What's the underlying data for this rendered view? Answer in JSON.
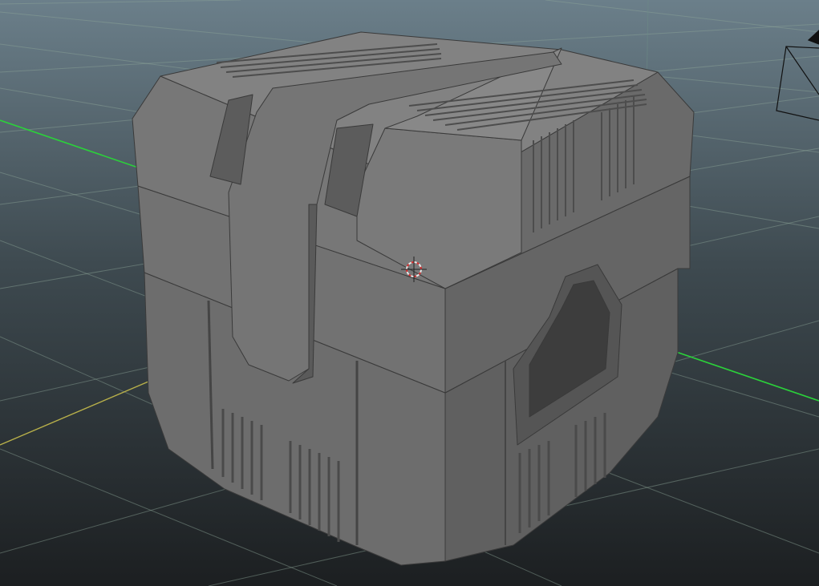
{
  "viewport": {
    "background_top": "#6b7f8a",
    "background_bottom": "#1c1f21",
    "grid_color": "#8fa79a",
    "x_axis_color": "#2bd13a",
    "z_axis_color": "#b8b04a"
  },
  "model": {
    "top_color": "#7b7b7b",
    "front_color": "#6a6a6a",
    "side_color": "#5e5e5e",
    "dark_color": "#4a4a4a"
  },
  "gizmos": {
    "pivot_icon": "pivot-manipulator-icon",
    "camera_icon": "camera-frustum-icon"
  }
}
